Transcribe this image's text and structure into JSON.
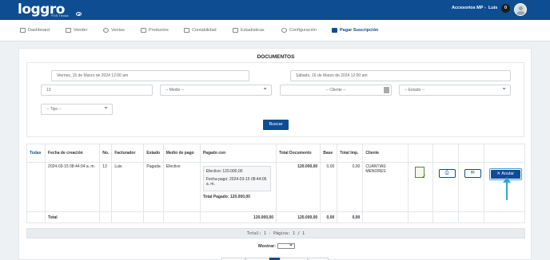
{
  "header": {
    "logo": "loggro",
    "logo_sub": "POS Tienda",
    "store": "Accesorios MP -",
    "user": "Luis",
    "notifications": "0"
  },
  "nav": [
    {
      "label": "Dashboard",
      "icon": "dashboard-icon"
    },
    {
      "label": "Vender",
      "icon": "cart-icon"
    },
    {
      "label": "Ventas",
      "icon": "dollar-icon"
    },
    {
      "label": "Productos",
      "icon": "box-icon"
    },
    {
      "label": "Contabilidad",
      "icon": "ledger-icon"
    },
    {
      "label": "Estadísticas",
      "icon": "chart-icon"
    },
    {
      "label": "Configuración",
      "icon": "gear-icon"
    },
    {
      "label": "Pagar Suscripción",
      "icon": "card-icon"
    }
  ],
  "page_title": "DOCUMENTOS",
  "filters": {
    "date_from": "Viernes, 15 de Marzo de 2024 12:00 am",
    "date_to": "Sábado, 16 de Marzo de 2024 12:00 am",
    "id_value": "13",
    "medio": "-- Medio --",
    "cliente": "-- Cliente --",
    "estado": "-- Estado --",
    "tipo": "-- Tipo --",
    "search_button": "Buscar"
  },
  "table": {
    "headers": {
      "todas": "Todas",
      "fecha": "Fecha de creación",
      "no": "No.",
      "facturador": "Facturador",
      "estado": "Estado",
      "medio": "Medio de pago",
      "pagado": "Pagado con",
      "total_doc": "Total Documento",
      "base": "Base",
      "total_imp": "Total Imp.",
      "cliente": "Cliente"
    },
    "row": {
      "fecha": "2024-03-15 08:44:04 a. m.",
      "no": "13",
      "facturador": "Luis",
      "estado": "Pagada",
      "medio": "Efectivo",
      "pago_linea1": "Efectivo: 120.000,00",
      "pago_linea2": "Fecha pago: 2024-03-15 08:44:05 a. m.",
      "total_pagado": "Total Pagado: 120.000,00",
      "total_doc": "120.000,00",
      "base": "0,00",
      "total_imp": "0,00",
      "cliente": "CUANTIAS MENORES",
      "anular": "Anular"
    },
    "totals": {
      "label": "Total",
      "pagado": "120.000,00",
      "total_doc": "120.000,00",
      "base": "0,00",
      "total_imp": "0,00"
    }
  },
  "pagination": {
    "summary": "Total: 1 - Página: 1 / 1",
    "mostrar": "Mostrar:"
  }
}
